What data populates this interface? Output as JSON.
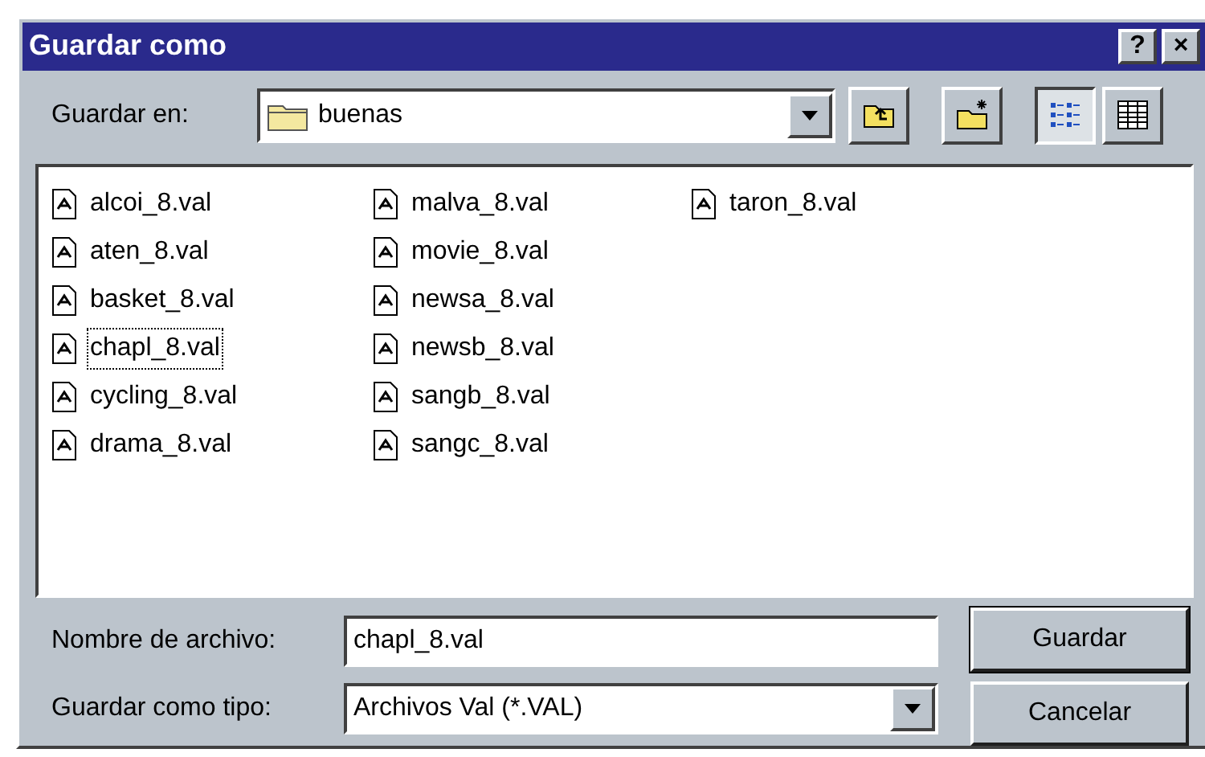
{
  "window": {
    "title": "Guardar como",
    "title_buttons": [
      "?",
      "×"
    ]
  },
  "location": {
    "label": "Guardar en:",
    "value": "buenas"
  },
  "toolbar": [
    {
      "kind": "up"
    },
    {
      "kind": "new-folder"
    },
    {
      "kind": "list",
      "selected": true
    },
    {
      "kind": "details",
      "selected": false
    }
  ],
  "files": [
    {
      "name": "alcoi_8.val",
      "focused": false
    },
    {
      "name": "aten_8.val",
      "focused": false
    },
    {
      "name": "basket_8.val",
      "focused": false
    },
    {
      "name": "chapl_8.val",
      "focused": true
    },
    {
      "name": "cycling_8.val",
      "focused": false
    },
    {
      "name": "drama_8.val",
      "focused": false
    },
    {
      "name": "malva_8.val",
      "focused": false
    },
    {
      "name": "movie_8.val",
      "focused": false
    },
    {
      "name": "newsa_8.val",
      "focused": false
    },
    {
      "name": "newsb_8.val",
      "focused": false
    },
    {
      "name": "sangb_8.val",
      "focused": false
    },
    {
      "name": "sangc_8.val",
      "focused": false
    },
    {
      "name": "taron_8.val",
      "focused": false
    }
  ],
  "filename": {
    "label": "Nombre de archivo:",
    "value": "chapl_8.val"
  },
  "filetype": {
    "label": "Guardar como tipo:",
    "value": "Archivos Val (*.VAL)"
  },
  "buttons": [
    "Guardar",
    "Cancelar"
  ]
}
